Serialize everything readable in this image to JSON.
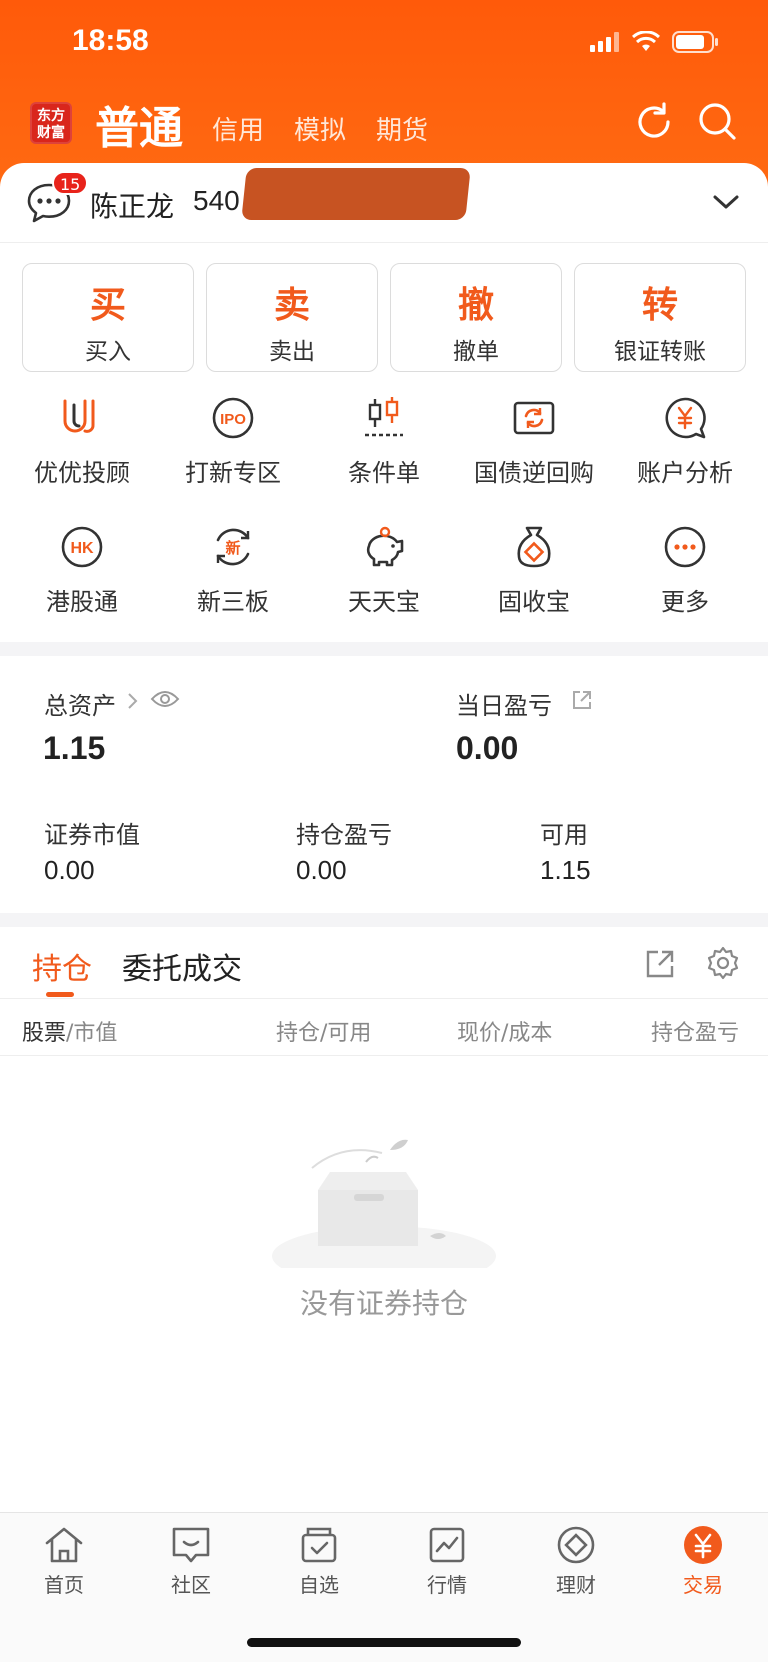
{
  "status_bar": {
    "time": "18:58"
  },
  "header": {
    "logo_text": "东方\n财富",
    "tabs": [
      {
        "label": "普通",
        "active": true
      },
      {
        "label": "信用"
      },
      {
        "label": "模拟"
      },
      {
        "label": "期货"
      }
    ]
  },
  "account": {
    "badge_count": "15",
    "name": "陈正龙",
    "id_prefix": "540"
  },
  "actions": [
    {
      "big": "买",
      "small": "买入"
    },
    {
      "big": "卖",
      "small": "卖出"
    },
    {
      "big": "撤",
      "small": "撤单"
    },
    {
      "big": "转",
      "small": "银证转账"
    }
  ],
  "grid": [
    {
      "label": "优优投顾",
      "icon": "youyou-icon"
    },
    {
      "label": "打新专区",
      "icon": "ipo-icon"
    },
    {
      "label": "条件单",
      "icon": "candlestick-icon"
    },
    {
      "label": "国债逆回购",
      "icon": "repo-icon"
    },
    {
      "label": "账户分析",
      "icon": "yuan-chat-icon"
    },
    {
      "label": "港股通",
      "icon": "hk-icon"
    },
    {
      "label": "新三板",
      "icon": "new-board-icon"
    },
    {
      "label": "天天宝",
      "icon": "piggy-bank-icon"
    },
    {
      "label": "固收宝",
      "icon": "money-bag-icon"
    },
    {
      "label": "更多",
      "icon": "more-icon"
    }
  ],
  "assets": {
    "total_label": "总资产",
    "total_value": "1.15",
    "daily_pl_label": "当日盈亏",
    "daily_pl_value": "0.00",
    "market_value_label": "证券市值",
    "market_value": "0.00",
    "holding_pl_label": "持仓盈亏",
    "holding_pl": "0.00",
    "available_label": "可用",
    "available": "1.15"
  },
  "positions": {
    "tabs": [
      "持仓",
      "委托成交"
    ],
    "columns": [
      {
        "main": "股票",
        "sub": "/市值"
      },
      {
        "main": "持仓",
        "sub": "/可用"
      },
      {
        "main": "现价",
        "sub": "/成本"
      },
      {
        "main": "持仓盈亏",
        "sub": ""
      }
    ],
    "empty_text": "没有证券持仓"
  },
  "bottom_nav": [
    {
      "label": "首页",
      "icon": "home-icon"
    },
    {
      "label": "社区",
      "icon": "community-icon"
    },
    {
      "label": "自选",
      "icon": "watchlist-icon"
    },
    {
      "label": "行情",
      "icon": "market-icon"
    },
    {
      "label": "理财",
      "icon": "wealth-icon"
    },
    {
      "label": "交易",
      "icon": "trade-yuan-icon",
      "active": true
    }
  ],
  "colors": {
    "brand": "#ff5a0a",
    "accent": "#f15a1c"
  }
}
